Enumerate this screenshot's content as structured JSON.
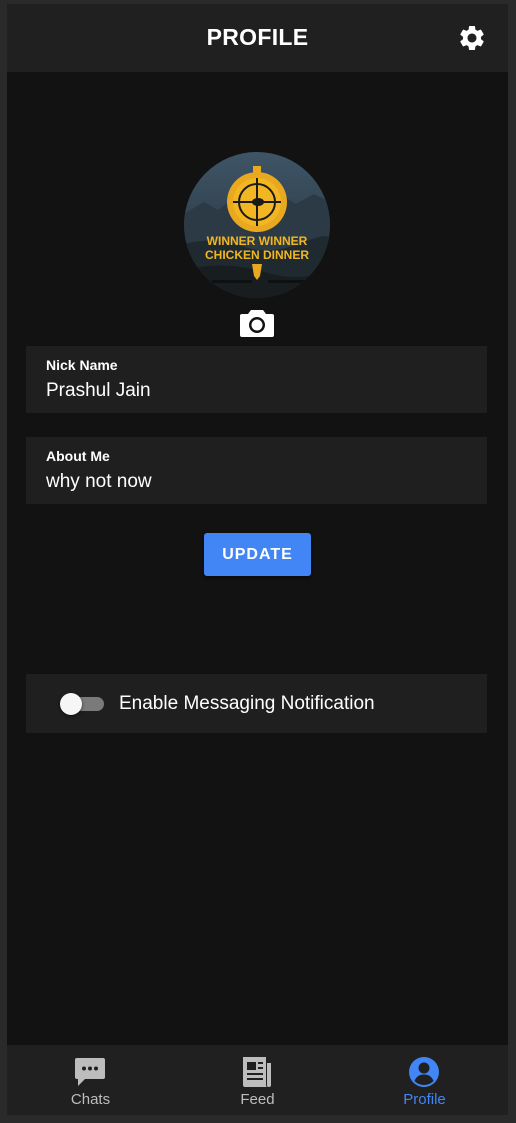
{
  "appbar": {
    "title": "PROFILE",
    "settings_icon": "gear-icon"
  },
  "profile": {
    "avatar_text_line1": "WINNER WINNER",
    "avatar_text_line2": "CHICKEN DINNER",
    "camera_icon": "camera-icon"
  },
  "fields": [
    {
      "label": "Nick Name",
      "value": "Prashul Jain"
    },
    {
      "label": "About Me",
      "value": "why not now"
    }
  ],
  "update_button": {
    "label": "UPDATE"
  },
  "notification": {
    "label": "Enable Messaging Notification",
    "enabled": false
  },
  "bottom_nav": [
    {
      "label": "Chats",
      "icon": "chat-bubble-icon",
      "active": false
    },
    {
      "label": "Feed",
      "icon": "newspaper-icon",
      "active": false
    },
    {
      "label": "Profile",
      "icon": "account-circle-icon",
      "active": true
    }
  ],
  "colors": {
    "background": "#121212",
    "surface": "#1f1f1f",
    "accent": "#4285f4",
    "inactive": "#bdbdbd"
  }
}
